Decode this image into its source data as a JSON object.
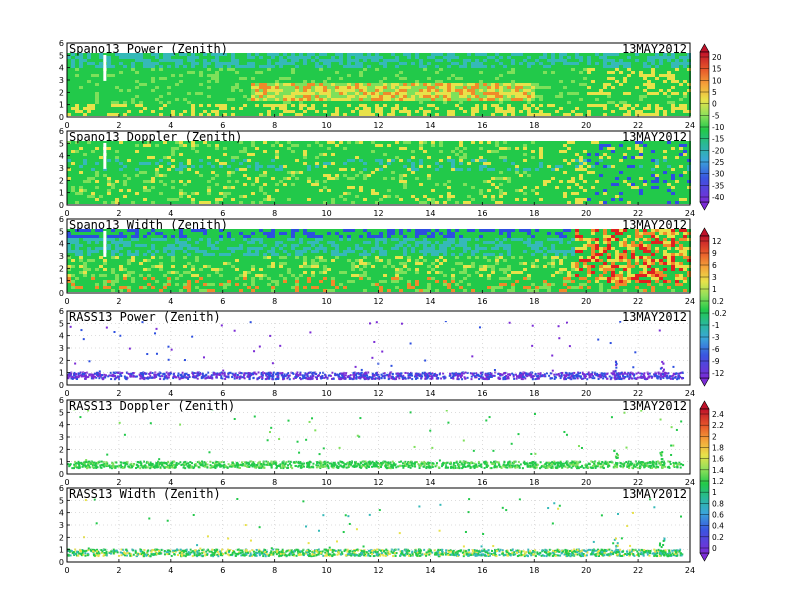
{
  "figure": {
    "date": "13MAY2012"
  },
  "chart_data": [
    {
      "type": "heatmap",
      "title": "Spano13 Power (Zenith)",
      "date": "13MAY2012",
      "xlim": [
        0,
        24
      ],
      "ylim": [
        0,
        6
      ],
      "colorbar": "top",
      "x_ticks": [
        "0",
        "2",
        "4",
        "6",
        "8",
        "10",
        "12",
        "14",
        "16",
        "18",
        "20",
        "22",
        "24"
      ],
      "y_ticks": [
        "0",
        "1",
        "2",
        "3",
        "4",
        "5",
        "6"
      ]
    },
    {
      "type": "heatmap",
      "title": "Spano13 Doppler (Zenith)",
      "date": "13MAY2012",
      "xlim": [
        0,
        24
      ],
      "ylim": [
        0,
        6
      ],
      "colorbar": "top",
      "x_ticks": [
        "0",
        "2",
        "4",
        "6",
        "8",
        "10",
        "12",
        "14",
        "16",
        "18",
        "20",
        "22",
        "24"
      ],
      "y_ticks": [
        "0",
        "1",
        "2",
        "3",
        "4",
        "5",
        "6"
      ]
    },
    {
      "type": "heatmap",
      "title": "Spano13 Width (Zenith)",
      "date": "13MAY2012",
      "xlim": [
        0,
        24
      ],
      "ylim": [
        0,
        6
      ],
      "colorbar": "middle",
      "x_ticks": [
        "0",
        "2",
        "4",
        "6",
        "8",
        "10",
        "12",
        "14",
        "16",
        "18",
        "20",
        "22",
        "24"
      ],
      "y_ticks": [
        "0",
        "1",
        "2",
        "3",
        "4",
        "5",
        "6"
      ]
    },
    {
      "type": "scatter",
      "title": "RASS13 Power (Zenith)",
      "date": "13MAY2012",
      "xlim": [
        0,
        24
      ],
      "ylim": [
        0,
        6
      ],
      "colorbar": "middle",
      "x_ticks": [
        "0",
        "2",
        "4",
        "6",
        "8",
        "10",
        "12",
        "14",
        "16",
        "18",
        "20",
        "22",
        "24"
      ],
      "y_ticks": [
        "0",
        "1",
        "2",
        "3",
        "4",
        "5",
        "6"
      ]
    },
    {
      "type": "scatter",
      "title": "RASS13 Doppler (Zenith)",
      "date": "13MAY2012",
      "xlim": [
        0,
        24
      ],
      "ylim": [
        0,
        6
      ],
      "colorbar": "bottom",
      "x_ticks": [
        "0",
        "2",
        "4",
        "6",
        "8",
        "10",
        "12",
        "14",
        "16",
        "18",
        "20",
        "22",
        "24"
      ],
      "y_ticks": [
        "0",
        "1",
        "2",
        "3",
        "4",
        "5",
        "6"
      ]
    },
    {
      "type": "scatter",
      "title": "RASS13 Width (Zenith)",
      "date": "13MAY2012",
      "xlim": [
        0,
        24
      ],
      "ylim": [
        0,
        6
      ],
      "colorbar": "bottom",
      "x_ticks": [
        "0",
        "2",
        "4",
        "6",
        "8",
        "10",
        "12",
        "14",
        "16",
        "18",
        "20",
        "22",
        "24"
      ],
      "y_ticks": [
        "0",
        "1",
        "2",
        "3",
        "4",
        "5",
        "6"
      ]
    }
  ],
  "colorbars": [
    {
      "name": "top",
      "labels": [
        "20",
        "15",
        "10",
        "5",
        "0",
        "-5",
        "-10",
        "-15",
        "-20",
        "-25",
        "-30",
        "-35",
        "-40"
      ]
    },
    {
      "name": "middle",
      "labels": [
        "12",
        "9",
        "6",
        "3",
        "1",
        "0.2",
        "-0.2",
        "-1",
        "-3",
        "-6",
        "-9",
        "-12"
      ]
    },
    {
      "name": "bottom",
      "labels": [
        "2.4",
        "2.2",
        "2",
        "1.8",
        "1.6",
        "1.4",
        "1.2",
        "1",
        "0.8",
        "0.6",
        "0.4",
        "0.2",
        "0"
      ]
    }
  ],
  "colors": {
    "green": "#22c94a",
    "light_green": "#7ee05a",
    "cyan": "#35b9b8",
    "blue": "#2d4fe0",
    "purple": "#7b2cd6",
    "yellow": "#e8e24a",
    "orange": "#f08a2a",
    "red": "#e02020"
  }
}
